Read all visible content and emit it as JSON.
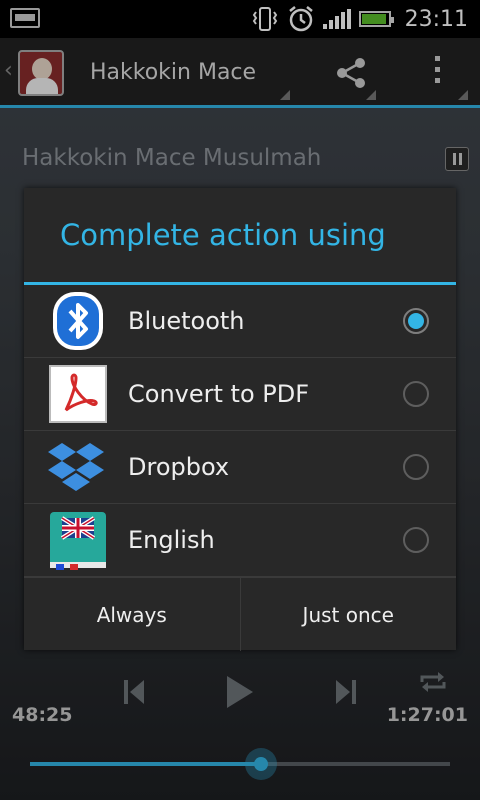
{
  "status_bar": {
    "time": "23:11"
  },
  "action_bar": {
    "title": "Hakkokin Mace"
  },
  "player": {
    "track_title": "Hakkokin Mace Musulmah",
    "elapsed": "48:25",
    "total": "1:27:01",
    "progress": 0.55
  },
  "dialog": {
    "title": "Complete action using",
    "items": [
      {
        "label": "Bluetooth",
        "icon": "bluetooth-icon",
        "selected": true
      },
      {
        "label": "Convert to PDF",
        "icon": "pdf-icon",
        "selected": false
      },
      {
        "label": "Dropbox",
        "icon": "dropbox-icon",
        "selected": false
      },
      {
        "label": "English",
        "icon": "dictionary-icon",
        "selected": false
      }
    ],
    "buttons": {
      "always": "Always",
      "just_once": "Just once"
    }
  },
  "colors": {
    "accent": "#33b5e5",
    "dialog_bg": "#282828"
  }
}
